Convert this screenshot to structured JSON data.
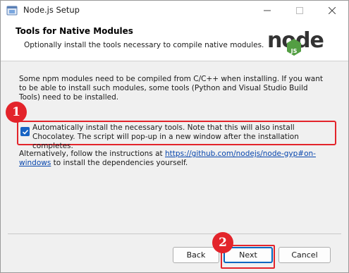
{
  "window": {
    "title": "Node.js Setup"
  },
  "header": {
    "title": "Tools for Native Modules",
    "subtitle": "Optionally install the tools necessary to compile native modules.",
    "logo_text": "node",
    "logo_badge": "JS"
  },
  "content": {
    "intro": "Some npm modules need to be compiled from C/C++ when installing. If you want to be able to install such modules, some tools (Python and Visual Studio Build Tools) need to be installed.",
    "checkbox_label": "Automatically install the necessary tools. Note that this will also install Chocolatey. The script will pop-up in a new window after the installation completes.",
    "checkbox_checked": true,
    "alt_prefix": "Alternatively, follow the instructions at ",
    "alt_link": "https://github.com/nodejs/node-gyp#on-windows",
    "alt_suffix": " to install the dependencies yourself."
  },
  "annotations": {
    "badge1": "1",
    "badge2": "2"
  },
  "buttons": {
    "back": "Back",
    "next": "Next",
    "cancel": "Cancel"
  },
  "colors": {
    "accent": "#0067c0",
    "highlight": "#e3242b",
    "node_green": "#539e43"
  }
}
